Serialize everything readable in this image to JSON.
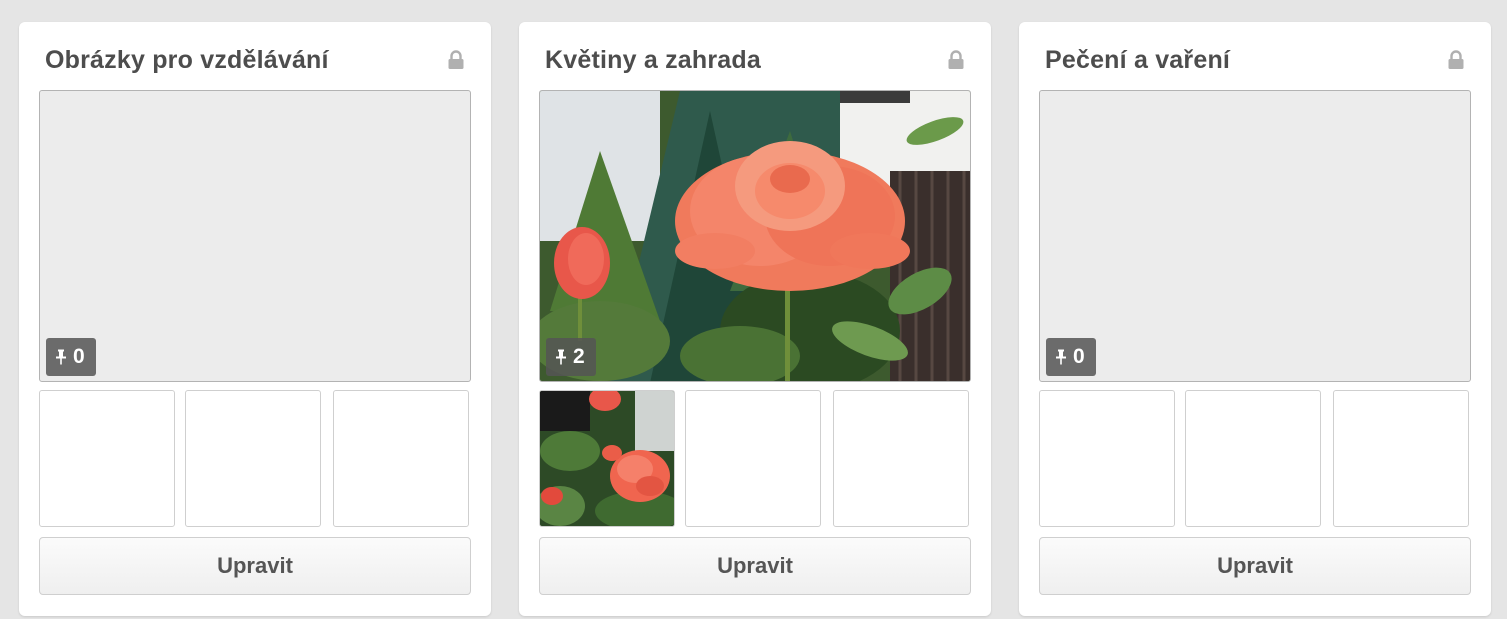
{
  "colors": {
    "page_background": "#e5e5e5",
    "card_background": "#ffffff",
    "title_text": "#4d4d4d",
    "placeholder": "#ececec",
    "badge_background": "#555555"
  },
  "boards": [
    {
      "title": "Obrázky pro vzdělávání",
      "lock_icon": "lock-icon",
      "cover_image": "empty placeholder",
      "pin_count": "0",
      "thumbnails": [
        "empty",
        "empty",
        "empty"
      ],
      "button_label": "Upravit"
    },
    {
      "title": "Květiny a zahrada",
      "lock_icon": "lock-icon",
      "cover_image": "photo of orange rose in garden",
      "pin_count": "2",
      "thumbnails": [
        "photo of red-orange roses",
        "empty",
        "empty"
      ],
      "button_label": "Upravit"
    },
    {
      "title": "Pečení a vaření",
      "lock_icon": "lock-icon",
      "cover_image": "empty placeholder",
      "pin_count": "0",
      "thumbnails": [
        "empty",
        "empty",
        "empty"
      ],
      "button_label": "Upravit"
    }
  ]
}
